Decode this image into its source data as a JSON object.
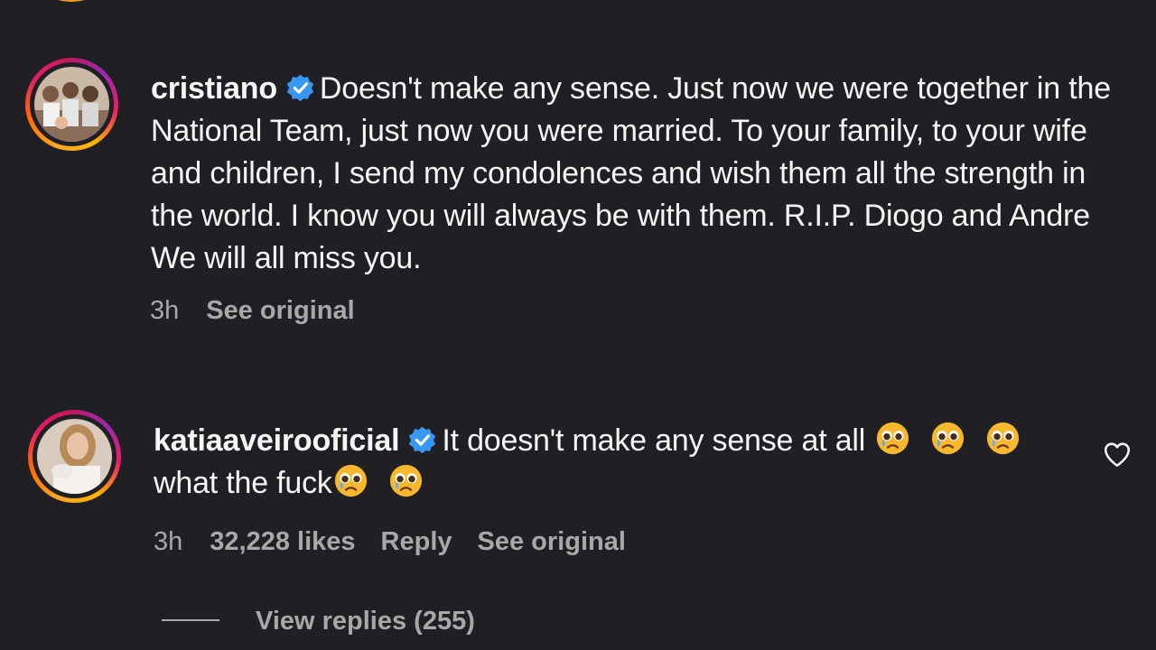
{
  "comments": [
    {
      "username": "cristiano",
      "verified": true,
      "text": "Doesn't make any sense. Just now we were together in the National Team, just now you were married. To your family, to your wife and children, I send my condolences and wish them all the strength in the world. I know you will always be with them. R.I.P. Diogo and Andre We will all miss you.",
      "time": "3h",
      "see_original": "See original"
    },
    {
      "username": "katiaaveirooficial",
      "verified": true,
      "text_part1": "It doesn't make any sense at all",
      "text_part2": "what the fuck",
      "emoji": "pleading-face-with-tear",
      "time": "3h",
      "likes": "32,228 likes",
      "reply": "Reply",
      "see_original": "See original",
      "liked": false
    }
  ],
  "view_replies": "View replies (255)",
  "colors": {
    "background": "#202024",
    "text": "#f5f5f5",
    "meta": "#a8a8a8",
    "verified": "#3897f0",
    "ring_start": "#f9a825",
    "ring_end": "#c2185b"
  }
}
